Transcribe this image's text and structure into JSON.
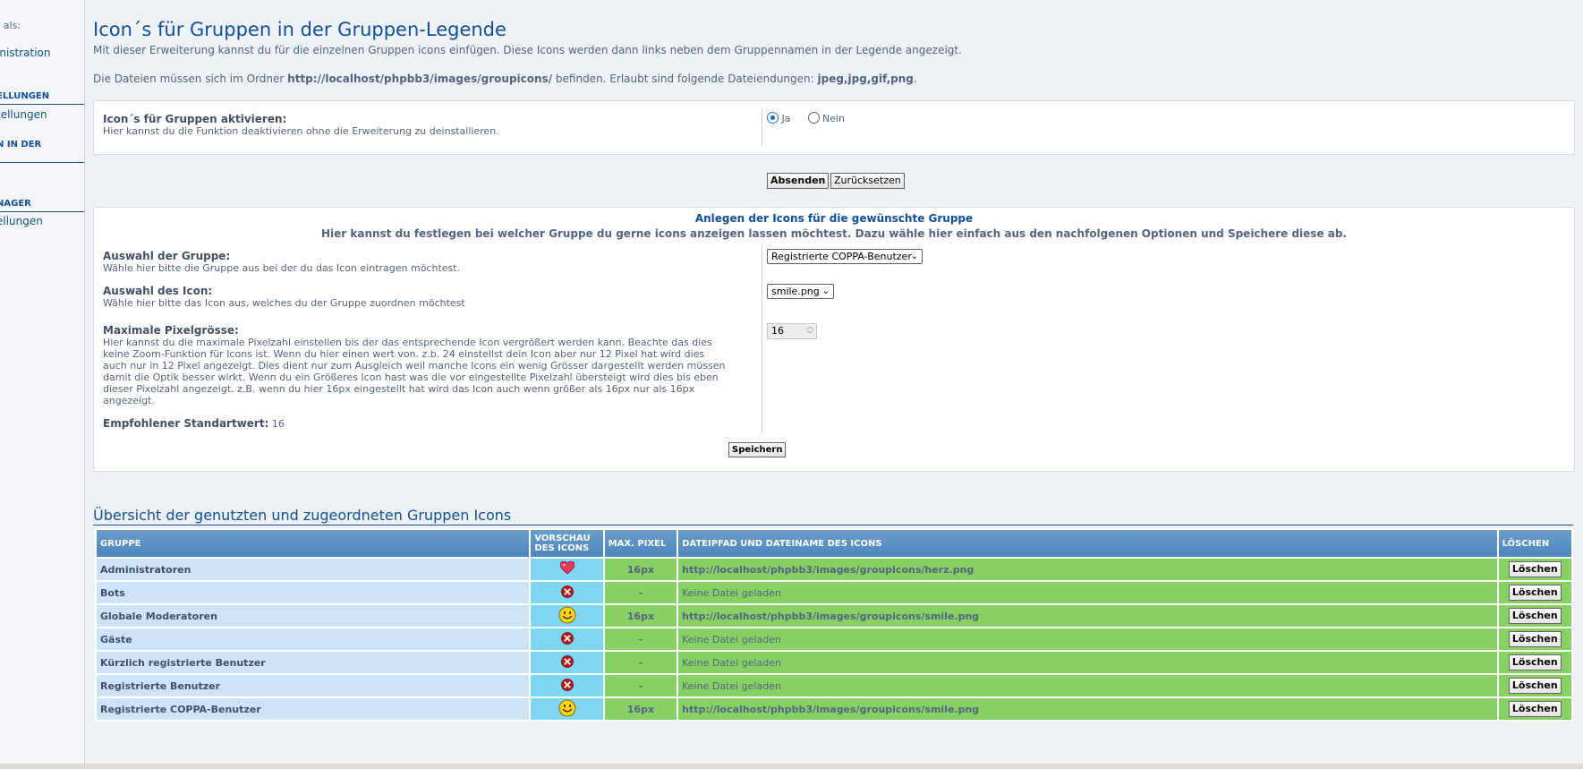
{
  "sidebar": {
    "logged_in_as": "t als:",
    "link_admin": "inistration",
    "section1": "ELLUNGEN",
    "link_settings": "tellungen",
    "section2": "N IN DER",
    "section3": "NAGER",
    "link_settings2": "ellungen"
  },
  "page": {
    "title": "Icon´s für Gruppen in der Gruppen-Legende",
    "intro1": "Mit dieser Erweiterung kannst du für die einzelnen Gruppen icons einfügen. Diese Icons werden dann links neben dem Gruppennamen in der Legende angezeigt.",
    "intro2_pre": "Die Dateien müssen sich im Ordner ",
    "intro2_path": "http://localhost/phpbb3/images/groupicons/",
    "intro2_mid": " befinden. Erlaubt sind folgende Dateiendungen: ",
    "intro2_ext": "jpeg,jpg,gif,png",
    "intro2_end": "."
  },
  "activate": {
    "title": "Icon´s für Gruppen aktivieren:",
    "desc": "Hier kannst du die Funktion deaktivieren ohne die Erweiterung zu deinstallieren.",
    "yes": "Ja",
    "no": "Nein",
    "selected": "Ja"
  },
  "form_buttons": {
    "submit": "Absenden",
    "reset": "Zurücksetzen"
  },
  "create": {
    "heading": "Anlegen der Icons für die gewünschte Gruppe",
    "subheading": "Hier kannst du festlegen bei welcher Gruppe du gerne icons anzeigen lassen möchtest. Dazu wähle hier einfach aus den nachfolgenen Optionen und Speichere diese ab.",
    "group_title": "Auswahl der Gruppe:",
    "group_desc": "Wähle hier bitte die Gruppe aus bei der du das Icon eintragen möchtest.",
    "group_value": "Registrierte COPPA-Benutzer",
    "icon_title": "Auswahl des Icon:",
    "icon_desc": "Wähle hier bitte das Icon aus, welches du der Gruppe zuordnen möchtest",
    "icon_value": "smile.png",
    "px_title": "Maximale Pixelgrösse:",
    "px_desc": [
      "Hier kannst du die maximale Pixelzahl einstellen bis der das entsprechende Icon vergrößert werden kann. Beachte das dies",
      "keine Zoom-Funktion für Icons ist. Wenn du hier einen wert von. z.b. 24 einstellst dein Icon aber nur 12 Pixel hat wird dies",
      "auch nur in 12 Pixel angezeigt. Dies dient nur zum Ausgleich weil manche Icons ein wenig Grösser dargestellt werden müssen",
      "damit die Optik besser wirkt. Wenn du ein Größeres Icon hast was die vor eingestellte Pixelzahl übersteigt wird dies bis eben",
      "dieser Pixelzahl angezeigt. z.B. wenn du hier 16px eingestellt hat wird das Icon auch wenn größer als 16px nur als 16px",
      "angezeigt."
    ],
    "px_value": "16",
    "recommended_label": "Empfohlener Standartwert:",
    "recommended_value": "16",
    "save": "Speichern"
  },
  "overview": {
    "title": "Übersicht der genutzten und zugeordneten Gruppen Icons",
    "columns": [
      "GRUPPE",
      "VORSCHAU DES ICONS",
      "MAX. PIXEL",
      "DATEIPFAD UND DATEINAME DES ICONS",
      "LÖSCHEN"
    ],
    "delete_label": "Löschen",
    "rows": [
      {
        "group": "Administratoren",
        "icon": "heart-icon",
        "px": "16px",
        "path": "http://localhost/phpbb3/images/groupicons/herz.png"
      },
      {
        "group": "Bots",
        "icon": "error-icon",
        "px": "-",
        "path": "Keine Datei geladen"
      },
      {
        "group": "Globale Moderatoren",
        "icon": "smile-icon",
        "px": "16px",
        "path": "http://localhost/phpbb3/images/groupicons/smile.png"
      },
      {
        "group": "Gäste",
        "icon": "error-icon",
        "px": "-",
        "path": "Keine Datei geladen"
      },
      {
        "group": "Kürzlich registrierte Benutzer",
        "icon": "error-icon",
        "px": "-",
        "path": "Keine Datei geladen"
      },
      {
        "group": "Registrierte Benutzer",
        "icon": "error-icon",
        "px": "-",
        "path": "Keine Datei geladen"
      },
      {
        "group": "Registrierte COPPA-Benutzer",
        "icon": "smile-icon",
        "px": "16px",
        "path": "http://localhost/phpbb3/images/groupicons/smile.png"
      }
    ]
  },
  "colors": {
    "title_blue": "#115098",
    "header_blue": "#5b93c6",
    "group_cell": "#cfe3f6",
    "preview_cell": "#7fd6f2",
    "green_cell": "#86d064"
  }
}
